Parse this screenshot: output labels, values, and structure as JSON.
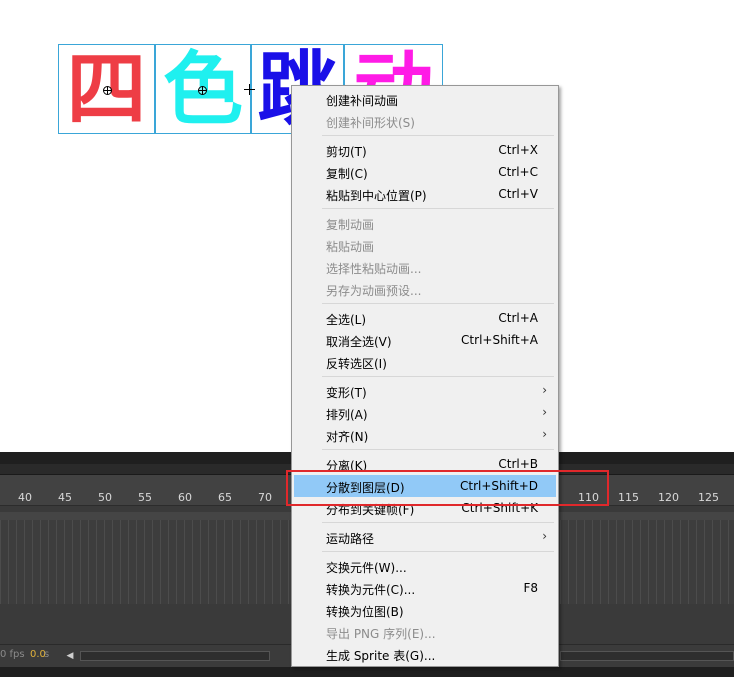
{
  "stage": {
    "characters": [
      {
        "text": "四",
        "color": "#ee3d45"
      },
      {
        "text": "色",
        "color": "#1ff0ef"
      },
      {
        "text": "跳",
        "color": "#1a10e8"
      },
      {
        "text": "动",
        "color": "#ff1be6"
      }
    ]
  },
  "timeline": {
    "ruler_numbers": [
      "40",
      "45",
      "50",
      "55",
      "60",
      "65",
      "70",
      "110",
      "115",
      "120",
      "125"
    ],
    "fps_text": "0 fps",
    "time_value": "0.0",
    "time_unit": "s"
  },
  "menu": {
    "items": [
      {
        "label": "创建补间动画",
        "shortcut": "",
        "enabled": true
      },
      {
        "label": "创建补间形状(S)",
        "shortcut": "",
        "enabled": false
      },
      {
        "label": "剪切(T)",
        "shortcut": "Ctrl+X",
        "enabled": true
      },
      {
        "label": "复制(C)",
        "shortcut": "Ctrl+C",
        "enabled": true
      },
      {
        "label": "粘贴到中心位置(P)",
        "shortcut": "Ctrl+V",
        "enabled": true
      },
      {
        "label": "复制动画",
        "shortcut": "",
        "enabled": false
      },
      {
        "label": "粘贴动画",
        "shortcut": "",
        "enabled": false
      },
      {
        "label": "选择性粘贴动画...",
        "shortcut": "",
        "enabled": false
      },
      {
        "label": "另存为动画预设...",
        "shortcut": "",
        "enabled": false
      },
      {
        "label": "全选(L)",
        "shortcut": "Ctrl+A",
        "enabled": true
      },
      {
        "label": "取消全选(V)",
        "shortcut": "Ctrl+Shift+A",
        "enabled": true
      },
      {
        "label": "反转选区(I)",
        "shortcut": "",
        "enabled": true
      },
      {
        "label": "变形(T)",
        "shortcut": "",
        "enabled": true,
        "submenu": true
      },
      {
        "label": "排列(A)",
        "shortcut": "",
        "enabled": true,
        "submenu": true
      },
      {
        "label": "对齐(N)",
        "shortcut": "",
        "enabled": true,
        "submenu": true
      },
      {
        "label": "分离(K)",
        "shortcut": "Ctrl+B",
        "enabled": true
      },
      {
        "label": "分散到图层(D)",
        "shortcut": "Ctrl+Shift+D",
        "enabled": true,
        "highlighted": true
      },
      {
        "label": "分布到关键帧(F)",
        "shortcut": "Ctrl+Shift+K",
        "enabled": true
      },
      {
        "label": "运动路径",
        "shortcut": "",
        "enabled": true,
        "submenu": true
      },
      {
        "label": "交换元件(W)...",
        "shortcut": "",
        "enabled": true
      },
      {
        "label": "转换为元件(C)...",
        "shortcut": "F8",
        "enabled": true
      },
      {
        "label": "转换为位图(B)",
        "shortcut": "",
        "enabled": true
      },
      {
        "label": "导出 PNG 序列(E)...",
        "shortcut": "",
        "enabled": false
      },
      {
        "label": "生成 Sprite 表(G)...",
        "shortcut": "",
        "enabled": true
      }
    ],
    "submenu_arrow": "›"
  }
}
